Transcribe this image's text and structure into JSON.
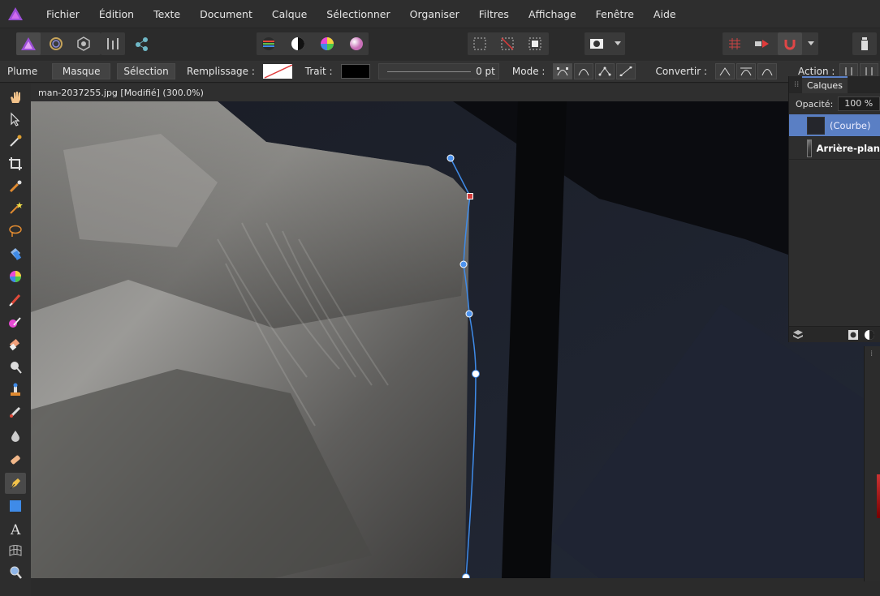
{
  "menu": {
    "items": [
      "Fichier",
      "Édition",
      "Texte",
      "Document",
      "Calque",
      "Sélectionner",
      "Organiser",
      "Filtres",
      "Affichage",
      "Fenêtre",
      "Aide"
    ]
  },
  "context": {
    "tool_name": "Plume",
    "mask_label": "Masque",
    "selection_label": "Sélection",
    "fill_label": "Remplissage :",
    "stroke_label": "Trait :",
    "stroke_width": "0 pt",
    "mode_label": "Mode :",
    "convert_label": "Convertir :",
    "action_label": "Action :"
  },
  "document": {
    "tab_title": "man-2037255.jpg [Modifié] (300.0%)"
  },
  "layers": {
    "tab_label": "Calques",
    "opacity_label": "Opacité:",
    "opacity_value": "100 %",
    "items": [
      {
        "name": "(Courbe)",
        "selected": true
      },
      {
        "name": "Arrière-plan",
        "selected": false
      }
    ]
  },
  "colors": {
    "accent": "#5a7fc4",
    "curve": "#3f8be8",
    "node_selected": "#d23a3a"
  },
  "icons": {
    "tools": [
      "hand-icon",
      "move-icon",
      "color-picker-icon",
      "crop-icon",
      "selection-brush-icon",
      "magic-wand-icon",
      "lasso-icon",
      "flood-fill-icon",
      "gradient-icon",
      "paint-brush-icon",
      "color-replace-icon",
      "eraser-icon",
      "dodge-icon",
      "clone-icon",
      "healing-icon",
      "blur-icon",
      "patch-icon",
      "pen-icon",
      "rectangle-icon",
      "text-icon",
      "mesh-warp-icon",
      "zoom-icon"
    ]
  }
}
